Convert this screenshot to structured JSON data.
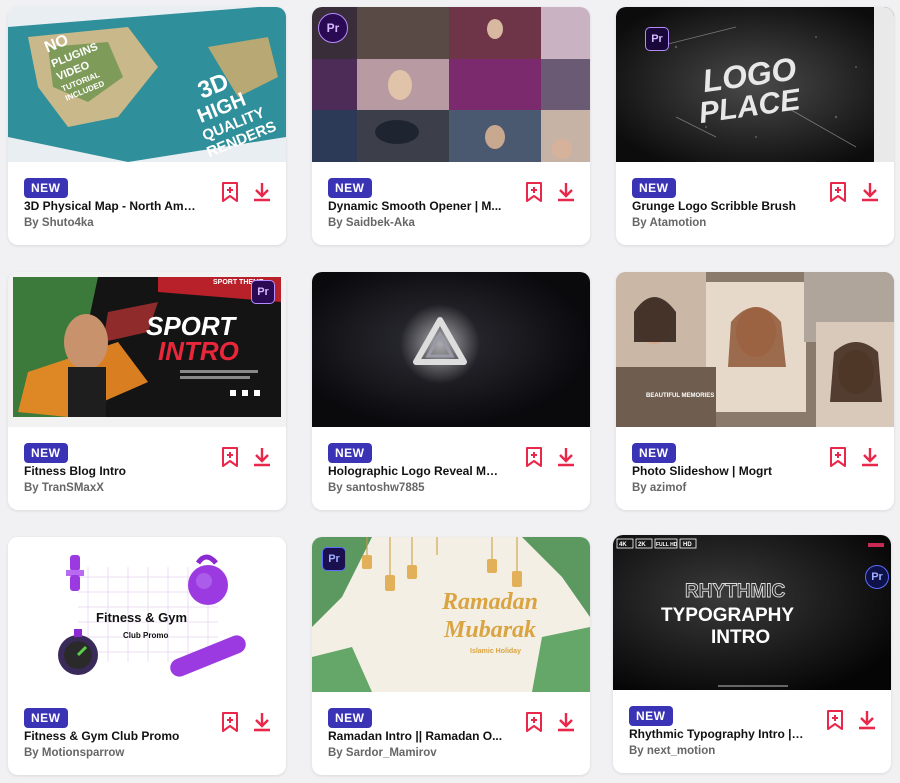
{
  "labels": {
    "badge": "NEW",
    "pr": "Pr"
  },
  "colors": {
    "accent": "#e8274a",
    "badge": "#3b33b6"
  },
  "cards": [
    {
      "title": "3D Physical Map - North Ame...",
      "author": "By Shuto4ka",
      "thumb": {
        "lines": [
          "NO",
          "PLUGINS",
          "VIDEO",
          "TUTORIAL",
          "INCLUDED",
          "3D",
          "HIGH",
          "QUALITY",
          "RENDERS"
        ]
      }
    },
    {
      "title": "Dynamic Smooth Opener | M...",
      "author": "By Saidbek-Aka",
      "thumb": {
        "lines": []
      }
    },
    {
      "title": "Grunge Logo Scribble Brush",
      "author": "By Atamotion",
      "thumb": {
        "lines": [
          "LOGO",
          "PLACE"
        ]
      }
    },
    {
      "title": "Fitness Blog Intro",
      "author": "By TranSMaxX",
      "thumb": {
        "lines": [
          "SPORT",
          "INTRO",
          "SPORT THEME"
        ]
      }
    },
    {
      "title": "Holographic Logo Reveal Mo...",
      "author": "By santoshw7885",
      "thumb": {
        "lines": []
      }
    },
    {
      "title": "Photo Slideshow | Mogrt",
      "author": "By azimof",
      "thumb": {
        "lines": [
          "BEAUTIFUL MEMORIES"
        ]
      }
    },
    {
      "title": "Fitness & Gym Club Promo",
      "author": "By Motionsparrow",
      "thumb": {
        "lines": [
          "Fitness & Gym",
          "Club Promo"
        ]
      }
    },
    {
      "title": "Ramadan Intro || Ramadan O...",
      "author": "By Sardor_Mamirov",
      "thumb": {
        "lines": [
          "Ramadan",
          "Mubarak",
          "Islamic Holiday"
        ]
      }
    },
    {
      "title": "Rhythmic Typography Intro | ...",
      "author": "By next_motion",
      "thumb": {
        "lines": [
          "RHYTHMIC",
          "TYPOGRAPHY",
          "INTRO",
          "4K",
          "2K",
          "FULL HD",
          "HD"
        ]
      }
    }
  ]
}
